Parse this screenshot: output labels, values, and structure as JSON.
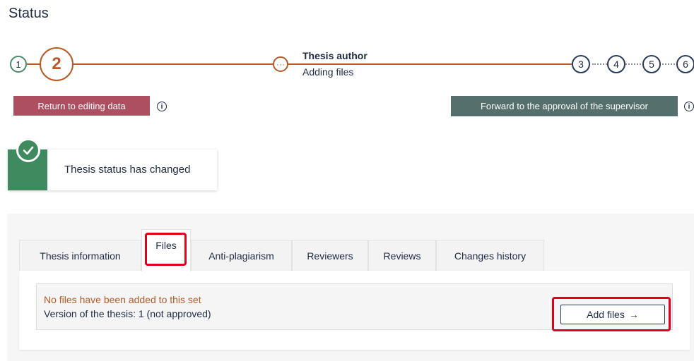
{
  "page": {
    "title": "Status"
  },
  "stepper": {
    "steps_done": [
      "1"
    ],
    "current_step": "2",
    "dots_icon": "···",
    "stage_title": "Thesis author",
    "stage_subtitle": "Adding files",
    "future_steps": [
      "3",
      "4",
      "5",
      "6"
    ]
  },
  "actions": {
    "return_label": "Return to editing data",
    "forward_label": "Forward to the approval of the supervisor",
    "info_glyph": "i"
  },
  "notification": {
    "text": "Thesis status has changed",
    "icon": "check-icon"
  },
  "tabs": [
    {
      "label": "Thesis information"
    },
    {
      "label": "Files"
    },
    {
      "label": "Anti-plagiarism"
    },
    {
      "label": "Reviewers"
    },
    {
      "label": "Reviews"
    },
    {
      "label": "Changes history"
    }
  ],
  "files": {
    "empty_message": "No files have been added to this set",
    "version_text": "Version of the thesis: 1 (not approved)",
    "add_button_label": "Add files",
    "add_button_arrow": "→"
  },
  "colors": {
    "accent_orange": "#b65a26",
    "return_button": "#ad4f60",
    "forward_button": "#55706c",
    "success_green": "#3f8a5e",
    "highlight_red": "#e0001a"
  }
}
